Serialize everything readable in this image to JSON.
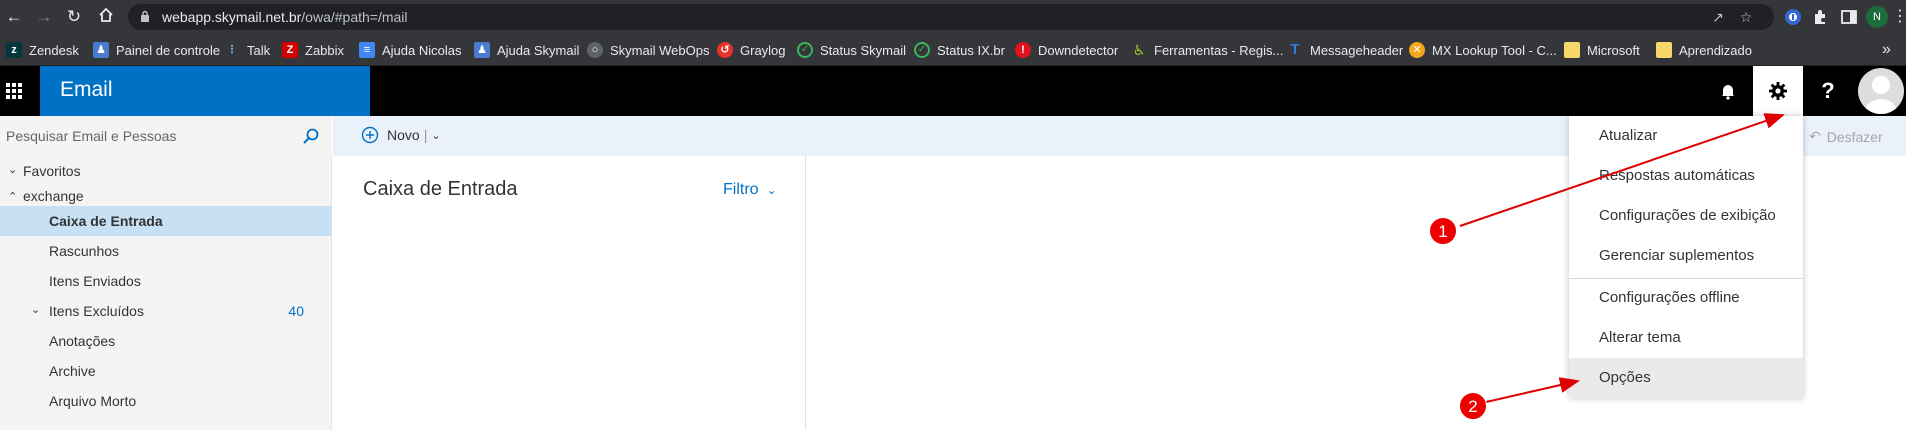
{
  "browser": {
    "url_host": "webapp.skymail.net.br",
    "url_path": "/owa/#path=/mail",
    "profile_initial": "N"
  },
  "bookmarks": [
    {
      "label": "Zendesk",
      "icon": "zendesk-icon",
      "color": "#03363d"
    },
    {
      "label": "Painel de controle",
      "icon": "people-icon",
      "color": "#4a7bd0"
    },
    {
      "label": "Talk",
      "icon": "talk-icon",
      "color": "#2f5ea8"
    },
    {
      "label": "Zabbix",
      "icon": "zabbix-icon",
      "color": "#d40000"
    },
    {
      "label": "Ajuda Nicolas",
      "icon": "doc-icon",
      "color": "#4285f4"
    },
    {
      "label": "Ajuda Skymail",
      "icon": "people-icon",
      "color": "#4a7bd0"
    },
    {
      "label": "Skymail WebOps",
      "icon": "globe-icon",
      "color": "#5f6368"
    },
    {
      "label": "Graylog",
      "icon": "graylog-icon",
      "color": "#e8322a"
    },
    {
      "label": "Status Skymail",
      "icon": "check-circle-icon",
      "color": "#3bb55a"
    },
    {
      "label": "Status IX.br",
      "icon": "check-circle-icon",
      "color": "#3bb55a"
    },
    {
      "label": "Downdetector",
      "icon": "alert-icon",
      "color": "#e0101e"
    },
    {
      "label": "Ferramentas - Regis...",
      "icon": "tools-icon",
      "color": "#9cc11c"
    },
    {
      "label": "Messageheader",
      "icon": "t-icon",
      "color": "#2f7fd8"
    },
    {
      "label": "MX Lookup Tool - C...",
      "icon": "mx-icon",
      "color": "#f2a81b"
    },
    {
      "label": "Microsoft",
      "icon": "folder-icon",
      "color": "#f6d56a"
    },
    {
      "label": "Aprendizado",
      "icon": "folder-icon",
      "color": "#f6d56a"
    }
  ],
  "header": {
    "app_title": "Email",
    "brand_color": "#0072c6"
  },
  "search": {
    "placeholder": "Pesquisar Email e Pessoas"
  },
  "commands": {
    "new_label": "Novo",
    "undo_label": "Desfazer"
  },
  "folders": {
    "favorites": "Favoritos",
    "account": "exchange",
    "items": [
      {
        "label": "Caixa de Entrada",
        "count": ""
      },
      {
        "label": "Rascunhos",
        "count": ""
      },
      {
        "label": "Itens Enviados",
        "count": ""
      },
      {
        "label": "Itens Excluídos",
        "count": "40"
      },
      {
        "label": "Anotações",
        "count": ""
      },
      {
        "label": "Archive",
        "count": ""
      },
      {
        "label": "Arquivo Morto",
        "count": ""
      }
    ]
  },
  "message_list": {
    "title": "Caixa de Entrada",
    "filter_label": "Filtro"
  },
  "settings_menu": {
    "items": [
      "Atualizar",
      "Respostas automáticas",
      "Configurações de exibição",
      "Gerenciar suplementos",
      "Configurações offline",
      "Alterar tema",
      "Opções"
    ]
  },
  "annotations": {
    "step1": "1",
    "step2": "2",
    "color": "#e00000"
  }
}
